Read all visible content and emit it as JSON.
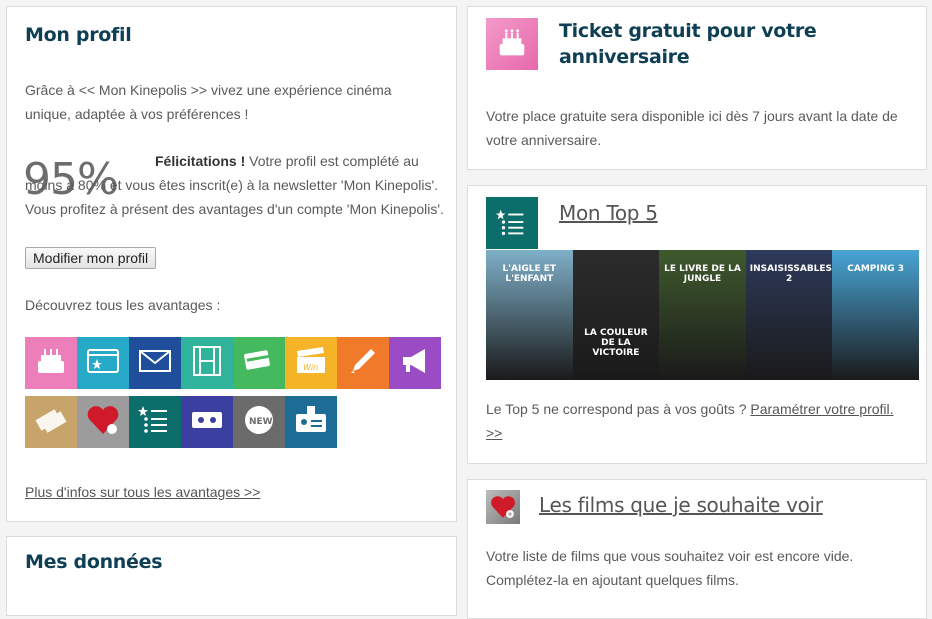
{
  "profile": {
    "title": "Mon profil",
    "intro": "Grâce à << Mon Kinepolis >> vivez une expérience cinéma unique, adaptée à vos préférences !",
    "percent": "95%",
    "congrats_bold": "Félicitations !",
    "congrats_text": " Votre profil est complété au moins à 80% et vous êtes inscrit(e) à la newsletter 'Mon Kinepolis'. Vous profitez à présent des avantages d'un compte 'Mon Kinepolis'.",
    "edit_button": "Modifier mon profil",
    "discover": "Découvrez tous les avantages :",
    "advantages": [
      {
        "icon": "birthday-cake-icon",
        "color": "#ec7fb9"
      },
      {
        "icon": "card-star-icon",
        "color": "#27a9c8"
      },
      {
        "icon": "envelope-icon",
        "color": "#1f4f9a"
      },
      {
        "icon": "film-strip-icon",
        "color": "#2fb39b"
      },
      {
        "icon": "loyalty-card-icon",
        "color": "#45b95e"
      },
      {
        "icon": "clapper-win-icon",
        "color": "#f5b327"
      },
      {
        "icon": "pencil-icon",
        "color": "#f07a2a"
      },
      {
        "icon": "megaphone-icon",
        "color": "#9b4bc4"
      },
      {
        "icon": "tickets-icon",
        "color": "#c7a56a"
      },
      {
        "icon": "heart-icon",
        "color": "#9c9c9c"
      },
      {
        "icon": "star-list-icon",
        "color": "#0b6e6a"
      },
      {
        "icon": "star-tickets-icon",
        "color": "#3b3f9f"
      },
      {
        "icon": "new-badge-icon",
        "color": "#6b6b6b"
      },
      {
        "icon": "id-card-icon",
        "color": "#1d6c95"
      }
    ],
    "more_link": "Plus d'infos sur tous les avantages >>"
  },
  "data_card": {
    "title": "Mes données"
  },
  "ticket": {
    "icon": "birthday-cake-icon",
    "title": "Ticket gratuit pour votre anniversaire",
    "body": "Votre place gratuite sera disponible ici dès 7 jours avant la date de votre anniversaire."
  },
  "top5": {
    "icon": "star-list-icon",
    "title": "Mon Top 5",
    "posters": [
      {
        "label": "L'AIGLE ET L'ENFANT",
        "bg": "#7fb0c9"
      },
      {
        "label": "LA COULEUR DE LA VICTOIRE",
        "bg": "#2c2c2c"
      },
      {
        "label": "LE LIVRE DE LA JUNGLE",
        "bg": "#3f5a2d"
      },
      {
        "label": "INSAISISSABLES 2",
        "bg": "#2d3a5a"
      },
      {
        "label": "CAMPING 3",
        "bg": "#49a5d6"
      }
    ],
    "body_text": "Le Top 5 ne correspond pas à vos goûts ? ",
    "body_link": "Paramétrer votre profil. >>"
  },
  "wish": {
    "icon": "heart-icon",
    "title": "Les films que je souhaite voir",
    "body": "Votre liste de films que vous souhaitez voir est encore vide. Complétez-la en ajoutant quelques films."
  }
}
